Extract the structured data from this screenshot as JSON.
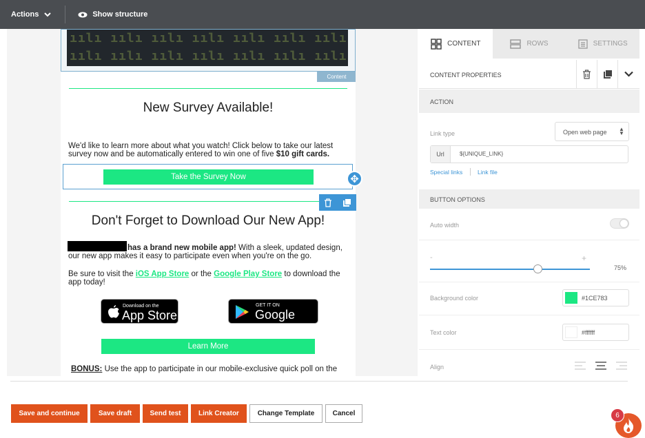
{
  "topbar": {
    "actions_label": "Actions",
    "show_structure_label": "Show structure"
  },
  "email": {
    "image_pattern": "ıılı ıılı ıılı ıılı ıılı ıılı ıılı ıılı",
    "content_tag": "Content",
    "survey_heading": "New Survey Available!",
    "survey_text_1": "We'd like to learn more about what you watch! Click below to take our latest survey now and be automatically entered to win one of five ",
    "survey_text_bold": "$10 gift cards.",
    "survey_button": "Take the Survey Now",
    "app_heading": "Don't Forget to Download Our New App!",
    "app_text_1a": "has a brand new mobile app!",
    "app_text_1b": " With a sleek, updated design, our new app makes it easy to participate even when you're on the go.",
    "app_text_2a": "Be sure to visit the ",
    "ios_link": "iOS App Store",
    "app_text_2b": " or the ",
    "play_link": "Google Play Store",
    "app_text_2c": " to download the app today!",
    "appstore_small": "Download on the",
    "appstore_big": "App Store",
    "googleplay_small": "GET IT ON",
    "googleplay_big": "Google Play",
    "learn_more_button": "Learn More",
    "bonus_label": "BONUS:",
    "bonus_text": " Use the app to participate in our mobile-exclusive quick poll on the"
  },
  "panel": {
    "tabs": [
      {
        "label": "CONTENT",
        "icon": "grid-icon",
        "active": true
      },
      {
        "label": "ROWS",
        "icon": "rows-icon",
        "active": false
      },
      {
        "label": "SETTINGS",
        "icon": "settings-icon",
        "active": false
      }
    ],
    "content_properties": "CONTENT PROPERTIES",
    "action_section": "ACTION",
    "link_type_label": "Link type",
    "link_type_value": "Open web page",
    "url_label": "Url",
    "url_value": "${UNIQUE_LINK}",
    "special_links": "Special links",
    "link_file": "Link file",
    "button_options_section": "BUTTON OPTIONS",
    "auto_width_label": "Auto width",
    "slider_minus": "-",
    "slider_plus": "+",
    "slider_value": "75%",
    "slider_fraction": 0.75,
    "bg_color_label": "Background color",
    "bg_color_value": "#1CE783",
    "text_color_label": "Text color",
    "text_color_value": "#ffffff",
    "align_label": "Align"
  },
  "bottom_buttons": {
    "save_continue": "Save and continue",
    "save_draft": "Save draft",
    "send_test": "Send test",
    "link_creator": "Link Creator",
    "change_template": "Change Template",
    "cancel": "Cancel"
  },
  "notification": {
    "badge_count": "6"
  },
  "colors": {
    "accent_green": "#1CE783",
    "orange": "#e0521c",
    "topbar": "#4a4d51",
    "selection_blue": "#3d95d6"
  }
}
